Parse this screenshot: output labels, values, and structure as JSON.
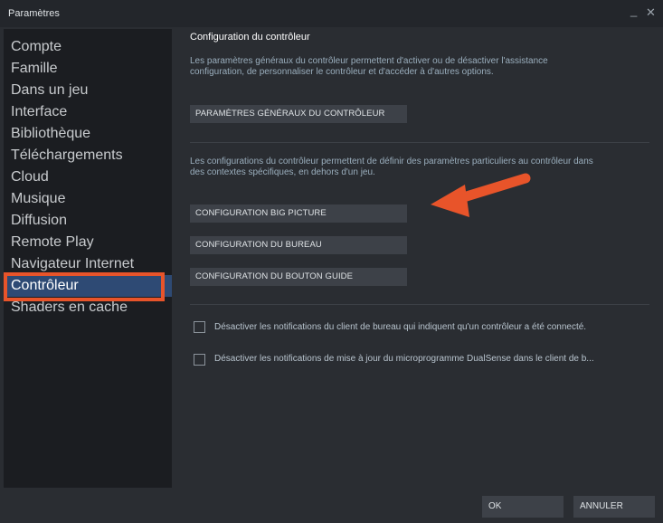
{
  "window": {
    "title": "Paramètres"
  },
  "sidebar": {
    "items": [
      {
        "label": "Compte"
      },
      {
        "label": "Famille"
      },
      {
        "label": "Dans un jeu"
      },
      {
        "label": "Interface"
      },
      {
        "label": "Bibliothèque"
      },
      {
        "label": "Téléchargements"
      },
      {
        "label": "Cloud"
      },
      {
        "label": "Musique"
      },
      {
        "label": "Diffusion"
      },
      {
        "label": "Remote Play"
      },
      {
        "label": "Navigateur Internet"
      },
      {
        "label": "Contrôleur"
      },
      {
        "label": "Shaders en cache"
      }
    ],
    "active_index": 11
  },
  "main": {
    "section_title": "Configuration du contrôleur",
    "desc1_line1": "Les paramètres généraux du contrôleur permettent d'activer ou de désactiver l'assistance",
    "desc1_line2": "configuration, de personnaliser le contrôleur et d'accéder à d'autres options.",
    "general_button": "PARAMÈTRES GÉNÉRAUX DU CONTRÔLEUR",
    "desc2_line1": "Les configurations du contrôleur permettent de définir des paramètres particuliers au contrôleur dans",
    "desc2_line2": "des contextes spécifiques, en dehors d'un jeu.",
    "bigpicture_button": "CONFIGURATION BIG PICTURE",
    "desktop_button": "CONFIGURATION DU BUREAU",
    "guide_button": "CONFIGURATION DU BOUTON GUIDE",
    "checkbox1_label": "Désactiver les notifications du client de bureau qui indiquent qu'un contrôleur a été connecté.",
    "checkbox2_label": "Désactiver les notifications de mise à jour du microprogramme DualSense dans le client de b..."
  },
  "footer": {
    "ok": "OK",
    "cancel": "ANNULER"
  },
  "colors": {
    "accent_annotation": "#e8542a",
    "active_item": "#2e4a74"
  }
}
